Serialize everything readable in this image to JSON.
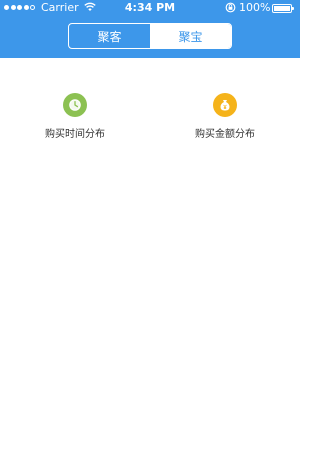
{
  "status_bar": {
    "carrier": "Carrier",
    "time": "4:34 PM",
    "battery": "100%"
  },
  "segmented": {
    "tabs": [
      {
        "label": "聚客",
        "active": false
      },
      {
        "label": "聚宝",
        "active": true
      }
    ]
  },
  "features": [
    {
      "label": "购买时间分布",
      "icon": "clock-icon",
      "color": "#8cc152"
    },
    {
      "label": "购买金额分布",
      "icon": "money-bag-icon",
      "color": "#f5b31a"
    }
  ],
  "colors": {
    "header": "#3d97ea"
  }
}
